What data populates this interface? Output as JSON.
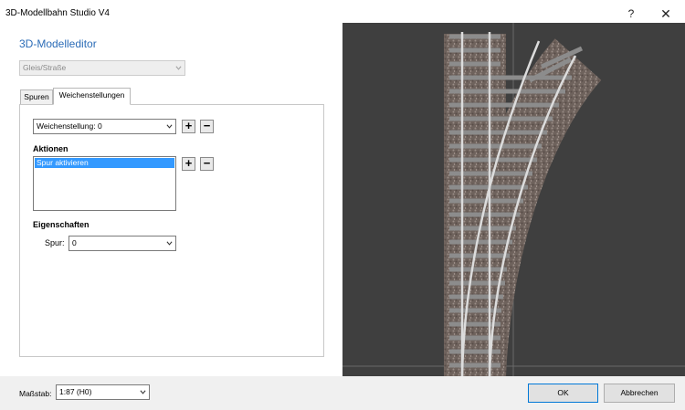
{
  "window": {
    "title": "3D-Modellbahn Studio V4",
    "help_glyph": "?",
    "close_glyph": "✕"
  },
  "editor": {
    "title": "3D-Modelleditor",
    "type_combo": {
      "value": "Gleis/Straße",
      "disabled": true
    }
  },
  "tabs": [
    {
      "label": "Spuren",
      "active": false
    },
    {
      "label": "Weichenstellungen",
      "active": true
    }
  ],
  "weichen": {
    "stellung_combo": {
      "value": "Weichenstellung: 0"
    },
    "add_glyph": "+",
    "remove_glyph": "−"
  },
  "aktionen": {
    "label": "Aktionen",
    "items": [
      "Spur aktivieren"
    ],
    "selected_index": 0,
    "add_glyph": "+",
    "remove_glyph": "−"
  },
  "eigenschaften": {
    "label": "Eigenschaften",
    "spur_label": "Spur:",
    "spur_value": "0"
  },
  "footer": {
    "massstab_label": "Maßstab:",
    "massstab_value": "1:87 (H0)",
    "ok_label": "OK",
    "cancel_label": "Abbrechen"
  },
  "colors": {
    "accent": "#2b6cb7",
    "selection": "#3399ff",
    "viewport_bg": "#3f3f3f",
    "ballast": "#6e625c",
    "sleeper": "#8c8c8c",
    "rail": "#dcdcdc"
  }
}
